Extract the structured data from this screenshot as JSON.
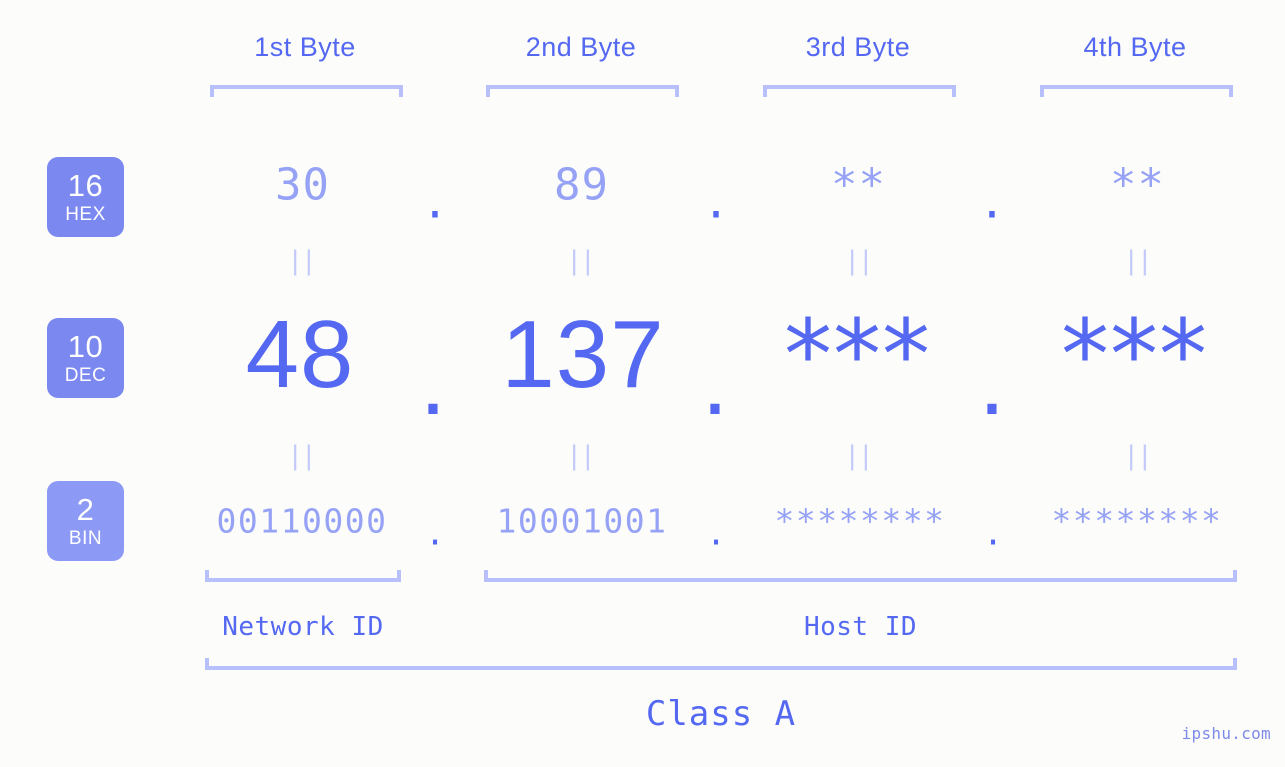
{
  "theme": {
    "background": "#fcfdfa",
    "accent": "#5468f2",
    "accent_light": "#96a2f5",
    "bracket": "#b8c0fb",
    "badge": "#7b88f0",
    "badge_bin": "#8c9af5",
    "separator": "#c3c9fb"
  },
  "headers": [
    {
      "label": "1st Byte"
    },
    {
      "label": "2nd Byte"
    },
    {
      "label": "3rd Byte"
    },
    {
      "label": "4th Byte"
    }
  ],
  "bases": [
    {
      "num": "16",
      "name": "HEX"
    },
    {
      "num": "10",
      "name": "DEC"
    },
    {
      "num": "2",
      "name": "BIN"
    }
  ],
  "rows": {
    "hex": {
      "values": [
        "30",
        "89",
        "**",
        "**"
      ],
      "separators": [
        ".",
        ".",
        "."
      ]
    },
    "dec": {
      "values": [
        "48",
        "137",
        "***",
        "***"
      ],
      "separators": [
        ".",
        ".",
        "."
      ]
    },
    "bin": {
      "values": [
        "00110000",
        "10001001",
        "********",
        "********"
      ],
      "separators": [
        ".",
        ".",
        "."
      ]
    }
  },
  "equals_marks": {
    "symbol": "||",
    "count_per_row": 4
  },
  "regions": [
    {
      "label": "Network ID"
    },
    {
      "label": "Host ID"
    }
  ],
  "class": {
    "label": "Class A"
  },
  "watermark": {
    "text": "ipshu.com"
  }
}
